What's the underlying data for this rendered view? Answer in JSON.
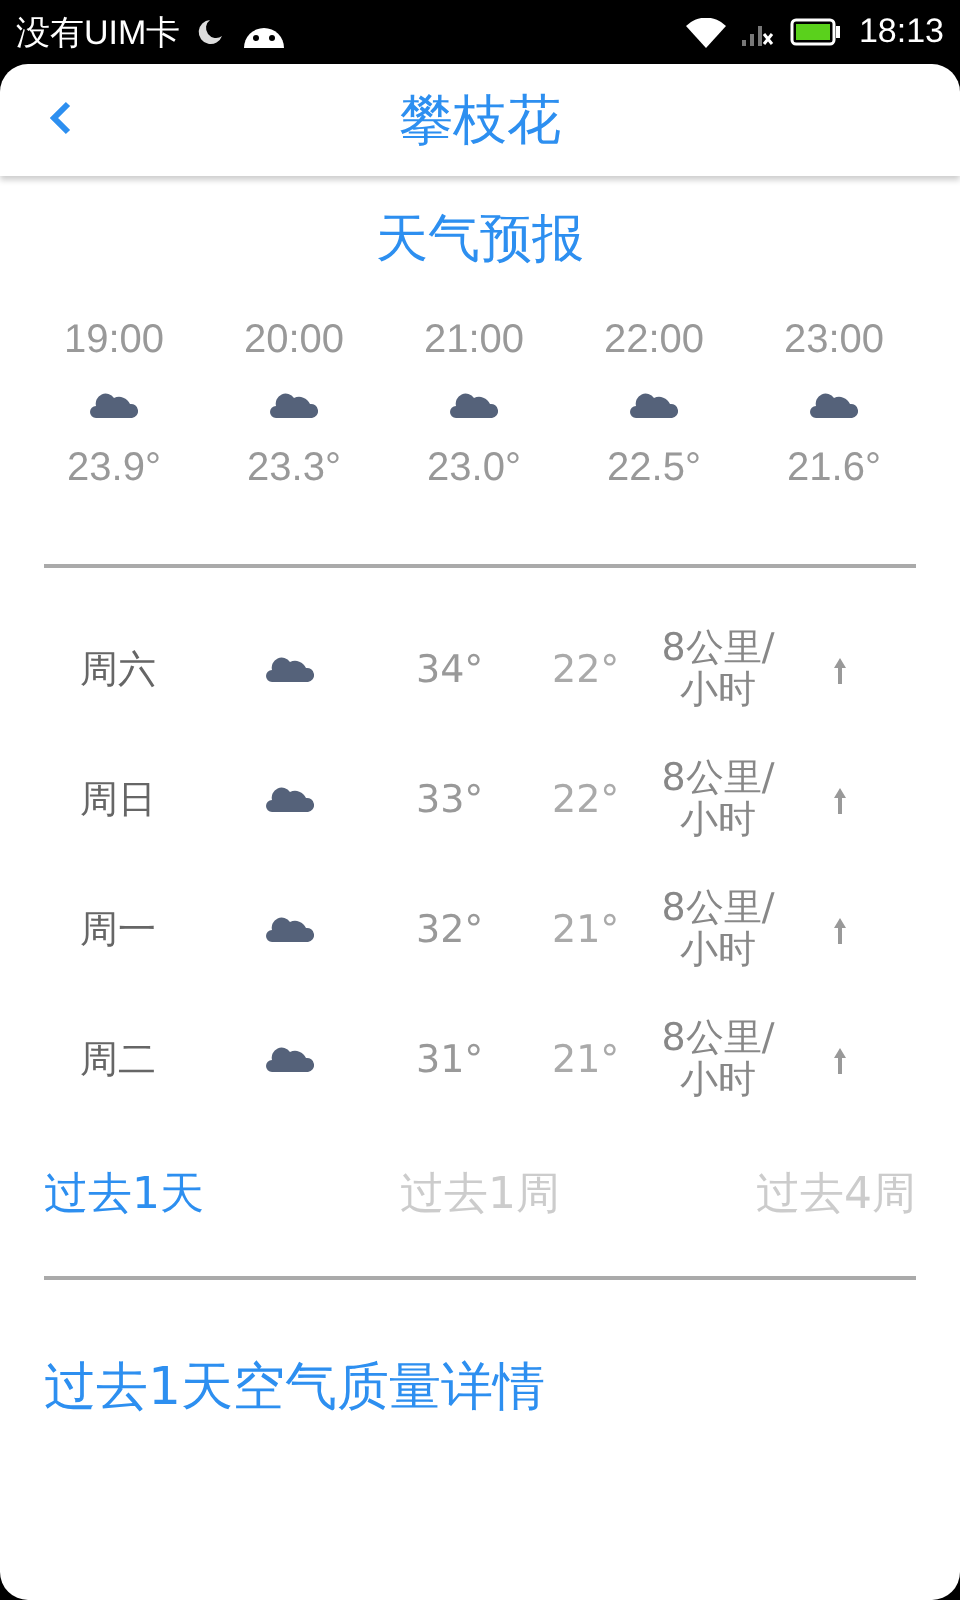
{
  "status_bar": {
    "carrier": "没有UIM卡",
    "time": "18:13"
  },
  "header": {
    "title": "攀枝花"
  },
  "section_title": "天气预报",
  "hourly": [
    {
      "time": "19:00",
      "temp": "23.9°"
    },
    {
      "time": "20:00",
      "temp": "23.3°"
    },
    {
      "time": "21:00",
      "temp": "23.0°"
    },
    {
      "time": "22:00",
      "temp": "22.5°"
    },
    {
      "time": "23:00",
      "temp": "21.6°"
    }
  ],
  "daily": [
    {
      "day": "周六",
      "high": "34°",
      "low": "22°",
      "wind": "8公里/小时"
    },
    {
      "day": "周日",
      "high": "33°",
      "low": "22°",
      "wind": "8公里/小时"
    },
    {
      "day": "周一",
      "high": "32°",
      "low": "21°",
      "wind": "8公里/小时"
    },
    {
      "day": "周二",
      "high": "31°",
      "low": "21°",
      "wind": "8公里/小时"
    }
  ],
  "tabs": [
    {
      "label": "过去1天",
      "selected": true
    },
    {
      "label": "过去1周",
      "selected": false
    },
    {
      "label": "过去4周",
      "selected": false
    }
  ],
  "air_quality_link": "过去1天空气质量详情"
}
